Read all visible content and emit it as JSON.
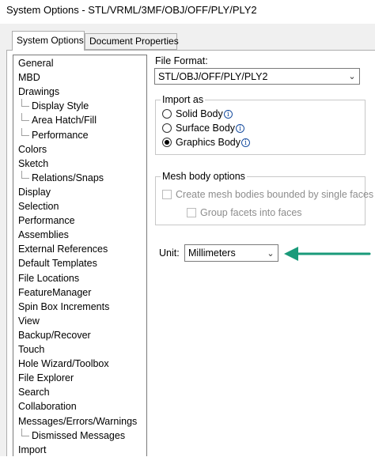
{
  "window": {
    "title": "System Options - STL/VRML/3MF/OBJ/OFF/PLY/PLY2"
  },
  "tabs": [
    {
      "label": "System Options",
      "active": true
    },
    {
      "label": "Document Properties",
      "active": false
    }
  ],
  "tree": [
    {
      "label": "General",
      "child": false
    },
    {
      "label": "MBD",
      "child": false
    },
    {
      "label": "Drawings",
      "child": false
    },
    {
      "label": "Display Style",
      "child": true
    },
    {
      "label": "Area Hatch/Fill",
      "child": true
    },
    {
      "label": "Performance",
      "child": true
    },
    {
      "label": "Colors",
      "child": false
    },
    {
      "label": "Sketch",
      "child": false
    },
    {
      "label": "Relations/Snaps",
      "child": true
    },
    {
      "label": "Display",
      "child": false
    },
    {
      "label": "Selection",
      "child": false
    },
    {
      "label": "Performance",
      "child": false
    },
    {
      "label": "Assemblies",
      "child": false
    },
    {
      "label": "External References",
      "child": false
    },
    {
      "label": "Default Templates",
      "child": false
    },
    {
      "label": "File Locations",
      "child": false
    },
    {
      "label": "FeatureManager",
      "child": false
    },
    {
      "label": "Spin Box Increments",
      "child": false
    },
    {
      "label": "View",
      "child": false
    },
    {
      "label": "Backup/Recover",
      "child": false
    },
    {
      "label": "Touch",
      "child": false
    },
    {
      "label": "Hole Wizard/Toolbox",
      "child": false
    },
    {
      "label": "File Explorer",
      "child": false
    },
    {
      "label": "Search",
      "child": false
    },
    {
      "label": "Collaboration",
      "child": false
    },
    {
      "label": "Messages/Errors/Warnings",
      "child": false
    },
    {
      "label": "Dismissed Messages",
      "child": true
    },
    {
      "label": "Import",
      "child": false
    }
  ],
  "file_format": {
    "label": "File Format:",
    "value": "STL/OBJ/OFF/PLY/PLY2"
  },
  "import_as": {
    "title": "Import as",
    "options": [
      {
        "label": "Solid Body",
        "selected": false
      },
      {
        "label": "Surface Body",
        "selected": false
      },
      {
        "label": "Graphics Body",
        "selected": true
      }
    ]
  },
  "mesh_options": {
    "title": "Mesh body options",
    "create_bounded": "Create mesh bodies bounded by single faces",
    "group_facets": "Group facets into faces"
  },
  "unit": {
    "label": "Unit:",
    "value": "Millimeters"
  },
  "colors": {
    "arrow": "#1a9a7a",
    "info_icon": "#1a4fa0"
  }
}
